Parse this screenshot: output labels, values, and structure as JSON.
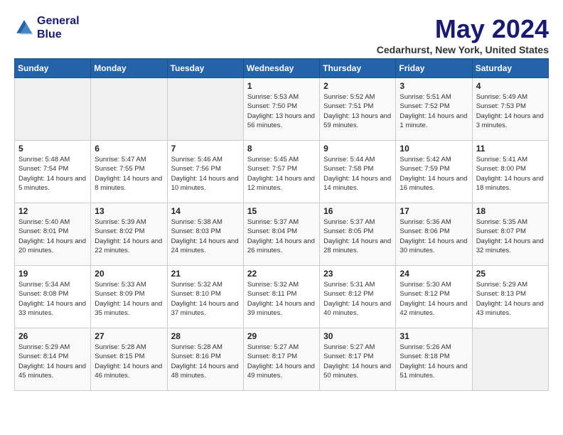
{
  "logo": {
    "line1": "General",
    "line2": "Blue"
  },
  "title": "May 2024",
  "location": "Cedarhurst, New York, United States",
  "days_of_week": [
    "Sunday",
    "Monday",
    "Tuesday",
    "Wednesday",
    "Thursday",
    "Friday",
    "Saturday"
  ],
  "weeks": [
    [
      {
        "day": "",
        "sunrise": "",
        "sunset": "",
        "daylight": ""
      },
      {
        "day": "",
        "sunrise": "",
        "sunset": "",
        "daylight": ""
      },
      {
        "day": "",
        "sunrise": "",
        "sunset": "",
        "daylight": ""
      },
      {
        "day": "1",
        "sunrise": "Sunrise: 5:53 AM",
        "sunset": "Sunset: 7:50 PM",
        "daylight": "Daylight: 13 hours and 56 minutes."
      },
      {
        "day": "2",
        "sunrise": "Sunrise: 5:52 AM",
        "sunset": "Sunset: 7:51 PM",
        "daylight": "Daylight: 13 hours and 59 minutes."
      },
      {
        "day": "3",
        "sunrise": "Sunrise: 5:51 AM",
        "sunset": "Sunset: 7:52 PM",
        "daylight": "Daylight: 14 hours and 1 minute."
      },
      {
        "day": "4",
        "sunrise": "Sunrise: 5:49 AM",
        "sunset": "Sunset: 7:53 PM",
        "daylight": "Daylight: 14 hours and 3 minutes."
      }
    ],
    [
      {
        "day": "5",
        "sunrise": "Sunrise: 5:48 AM",
        "sunset": "Sunset: 7:54 PM",
        "daylight": "Daylight: 14 hours and 5 minutes."
      },
      {
        "day": "6",
        "sunrise": "Sunrise: 5:47 AM",
        "sunset": "Sunset: 7:55 PM",
        "daylight": "Daylight: 14 hours and 8 minutes."
      },
      {
        "day": "7",
        "sunrise": "Sunrise: 5:46 AM",
        "sunset": "Sunset: 7:56 PM",
        "daylight": "Daylight: 14 hours and 10 minutes."
      },
      {
        "day": "8",
        "sunrise": "Sunrise: 5:45 AM",
        "sunset": "Sunset: 7:57 PM",
        "daylight": "Daylight: 14 hours and 12 minutes."
      },
      {
        "day": "9",
        "sunrise": "Sunrise: 5:44 AM",
        "sunset": "Sunset: 7:58 PM",
        "daylight": "Daylight: 14 hours and 14 minutes."
      },
      {
        "day": "10",
        "sunrise": "Sunrise: 5:42 AM",
        "sunset": "Sunset: 7:59 PM",
        "daylight": "Daylight: 14 hours and 16 minutes."
      },
      {
        "day": "11",
        "sunrise": "Sunrise: 5:41 AM",
        "sunset": "Sunset: 8:00 PM",
        "daylight": "Daylight: 14 hours and 18 minutes."
      }
    ],
    [
      {
        "day": "12",
        "sunrise": "Sunrise: 5:40 AM",
        "sunset": "Sunset: 8:01 PM",
        "daylight": "Daylight: 14 hours and 20 minutes."
      },
      {
        "day": "13",
        "sunrise": "Sunrise: 5:39 AM",
        "sunset": "Sunset: 8:02 PM",
        "daylight": "Daylight: 14 hours and 22 minutes."
      },
      {
        "day": "14",
        "sunrise": "Sunrise: 5:38 AM",
        "sunset": "Sunset: 8:03 PM",
        "daylight": "Daylight: 14 hours and 24 minutes."
      },
      {
        "day": "15",
        "sunrise": "Sunrise: 5:37 AM",
        "sunset": "Sunset: 8:04 PM",
        "daylight": "Daylight: 14 hours and 26 minutes."
      },
      {
        "day": "16",
        "sunrise": "Sunrise: 5:37 AM",
        "sunset": "Sunset: 8:05 PM",
        "daylight": "Daylight: 14 hours and 28 minutes."
      },
      {
        "day": "17",
        "sunrise": "Sunrise: 5:36 AM",
        "sunset": "Sunset: 8:06 PM",
        "daylight": "Daylight: 14 hours and 30 minutes."
      },
      {
        "day": "18",
        "sunrise": "Sunrise: 5:35 AM",
        "sunset": "Sunset: 8:07 PM",
        "daylight": "Daylight: 14 hours and 32 minutes."
      }
    ],
    [
      {
        "day": "19",
        "sunrise": "Sunrise: 5:34 AM",
        "sunset": "Sunset: 8:08 PM",
        "daylight": "Daylight: 14 hours and 33 minutes."
      },
      {
        "day": "20",
        "sunrise": "Sunrise: 5:33 AM",
        "sunset": "Sunset: 8:09 PM",
        "daylight": "Daylight: 14 hours and 35 minutes."
      },
      {
        "day": "21",
        "sunrise": "Sunrise: 5:32 AM",
        "sunset": "Sunset: 8:10 PM",
        "daylight": "Daylight: 14 hours and 37 minutes."
      },
      {
        "day": "22",
        "sunrise": "Sunrise: 5:32 AM",
        "sunset": "Sunset: 8:11 PM",
        "daylight": "Daylight: 14 hours and 39 minutes."
      },
      {
        "day": "23",
        "sunrise": "Sunrise: 5:31 AM",
        "sunset": "Sunset: 8:12 PM",
        "daylight": "Daylight: 14 hours and 40 minutes."
      },
      {
        "day": "24",
        "sunrise": "Sunrise: 5:30 AM",
        "sunset": "Sunset: 8:12 PM",
        "daylight": "Daylight: 14 hours and 42 minutes."
      },
      {
        "day": "25",
        "sunrise": "Sunrise: 5:29 AM",
        "sunset": "Sunset: 8:13 PM",
        "daylight": "Daylight: 14 hours and 43 minutes."
      }
    ],
    [
      {
        "day": "26",
        "sunrise": "Sunrise: 5:29 AM",
        "sunset": "Sunset: 8:14 PM",
        "daylight": "Daylight: 14 hours and 45 minutes."
      },
      {
        "day": "27",
        "sunrise": "Sunrise: 5:28 AM",
        "sunset": "Sunset: 8:15 PM",
        "daylight": "Daylight: 14 hours and 46 minutes."
      },
      {
        "day": "28",
        "sunrise": "Sunrise: 5:28 AM",
        "sunset": "Sunset: 8:16 PM",
        "daylight": "Daylight: 14 hours and 48 minutes."
      },
      {
        "day": "29",
        "sunrise": "Sunrise: 5:27 AM",
        "sunset": "Sunset: 8:17 PM",
        "daylight": "Daylight: 14 hours and 49 minutes."
      },
      {
        "day": "30",
        "sunrise": "Sunrise: 5:27 AM",
        "sunset": "Sunset: 8:17 PM",
        "daylight": "Daylight: 14 hours and 50 minutes."
      },
      {
        "day": "31",
        "sunrise": "Sunrise: 5:26 AM",
        "sunset": "Sunset: 8:18 PM",
        "daylight": "Daylight: 14 hours and 51 minutes."
      },
      {
        "day": "",
        "sunrise": "",
        "sunset": "",
        "daylight": ""
      }
    ]
  ]
}
